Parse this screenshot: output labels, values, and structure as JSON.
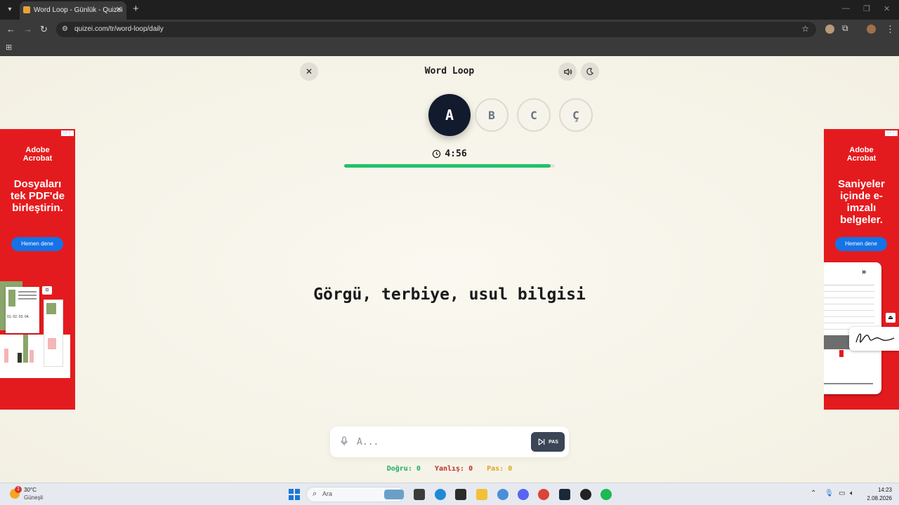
{
  "browser": {
    "tab_title": "Word Loop - Günlük - Quizei",
    "url": "quizei.com/tr/word-loop/daily"
  },
  "game": {
    "title": "Word Loop",
    "letters": [
      "A",
      "B",
      "C",
      "Ç"
    ],
    "active_letter": "A",
    "timer": "4:56",
    "time_progress": 0.98,
    "clue": "Görgü, terbiye, usul bilgisi",
    "answer_placeholder": "A...",
    "pass_label": "PAS",
    "score": {
      "correct_label": "Doğru: 0",
      "wrong_label": "Yanlış: 0",
      "pass_label": "Pas: 0"
    },
    "colors": {
      "active_letter_bg": "#121a2e",
      "progress": "#22c16b",
      "correct": "#1fae5c",
      "wrong": "#c0312c",
      "pass": "#e0a524"
    }
  },
  "ads": {
    "left": {
      "brand": "Adobe Acrobat",
      "headline": "Dosyaları tek PDF'de birleştirin.",
      "cta": "Hemen dene",
      "illustration_text": "01. 02. 03. 04."
    },
    "right": {
      "brand": "Adobe Acrobat",
      "headline": "Saniyeler içinde e-imzalı belgeler.",
      "cta": "Hemen dene"
    },
    "color": "#e41b1e"
  },
  "taskbar": {
    "weather_temp": "30°C",
    "weather_condition": "Güneşli",
    "weather_badge": "1",
    "search_placeholder": "Ara",
    "time": "14:23",
    "date": "2.08.2026"
  }
}
